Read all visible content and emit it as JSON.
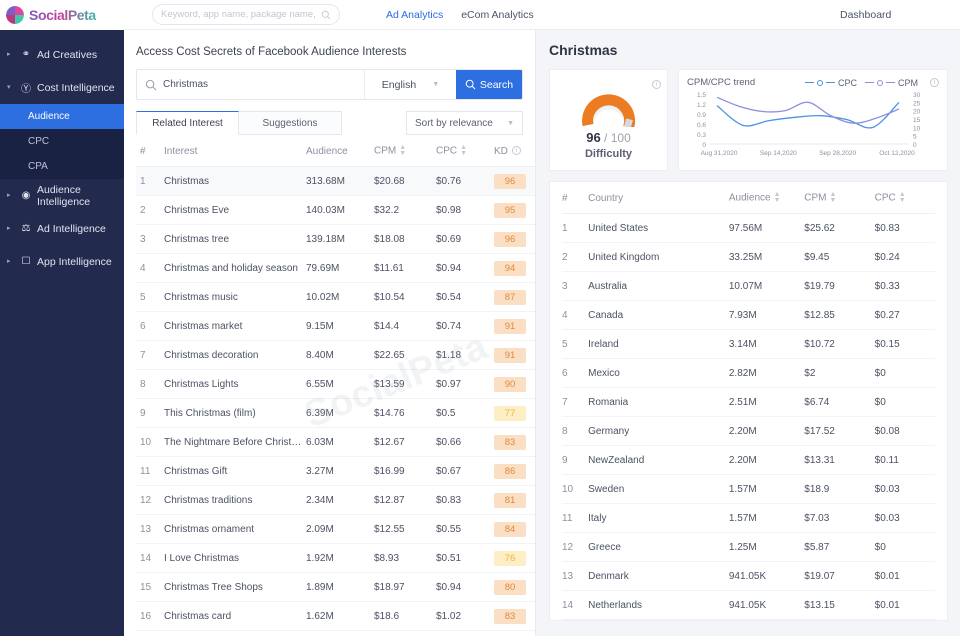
{
  "brand": {
    "name": "SocialPeta",
    "logo_icon": "socialpeta-logo-icon"
  },
  "topbar": {
    "search_placeholder": "Keyword, app name, package name, text ·",
    "search_value": "",
    "search_icon": "search-icon",
    "nav": [
      {
        "label": "Ad Analytics",
        "active": true
      },
      {
        "label": "eCom Analytics",
        "active": false
      }
    ],
    "dashboard_label": "Dashboard"
  },
  "sidebar": {
    "items": [
      {
        "label": "Ad Creatives",
        "icon": "lightbulb-icon",
        "caret": "▸",
        "expanded": false
      },
      {
        "label": "Cost Intelligence",
        "icon": "dollar-circle-icon",
        "caret": "▾",
        "expanded": true
      },
      {
        "label": "Audience Intelligence",
        "icon": "target-icon",
        "caret": "▸",
        "expanded": false
      },
      {
        "label": "Ad Intelligence",
        "icon": "trophy-icon",
        "caret": "▸",
        "expanded": false
      },
      {
        "label": "App Intelligence",
        "icon": "mobile-icon",
        "caret": "▸",
        "expanded": false
      }
    ],
    "cost_children": [
      {
        "label": "Audience",
        "active": true
      },
      {
        "label": "CPC",
        "active": false
      },
      {
        "label": "CPA",
        "active": false
      }
    ]
  },
  "main": {
    "title": "Access Cost Secrets of Facebook Audience Interests",
    "search": {
      "value": "Christmas",
      "placeholder": "Christmas",
      "search_icon": "search-icon",
      "language": "English",
      "language_chevron_icon": "chevron-down-icon",
      "button_label": "Search",
      "button_icon": "search-icon"
    },
    "tabs": [
      {
        "label": "Related Interest",
        "active": true
      },
      {
        "label": "Suggestions",
        "active": false
      }
    ],
    "sort": {
      "label": "Sort by relevance",
      "chevron_icon": "chevron-down-icon"
    },
    "table": {
      "headers": [
        "#",
        "Interest",
        "Audience",
        "CPM",
        "CPC",
        "KD"
      ],
      "kd_info_icon": "info-icon",
      "sortable": [
        "CPM",
        "CPC"
      ],
      "rows": [
        {
          "num": "1",
          "interest": "Christmas",
          "audience": "313.68M",
          "cpm": "$20.68",
          "cpc": "$0.76",
          "kd": "96"
        },
        {
          "num": "2",
          "interest": "Christmas Eve",
          "audience": "140.03M",
          "cpm": "$32.2",
          "cpc": "$0.98",
          "kd": "95"
        },
        {
          "num": "3",
          "interest": "Christmas tree",
          "audience": "139.18M",
          "cpm": "$18.08",
          "cpc": "$0.69",
          "kd": "96"
        },
        {
          "num": "4",
          "interest": "Christmas and holiday season",
          "audience": "79.69M",
          "cpm": "$11.61",
          "cpc": "$0.94",
          "kd": "94"
        },
        {
          "num": "5",
          "interest": "Christmas music",
          "audience": "10.02M",
          "cpm": "$10.54",
          "cpc": "$0.54",
          "kd": "87"
        },
        {
          "num": "6",
          "interest": "Christmas market",
          "audience": "9.15M",
          "cpm": "$14.4",
          "cpc": "$0.74",
          "kd": "91"
        },
        {
          "num": "7",
          "interest": "Christmas decoration",
          "audience": "8.40M",
          "cpm": "$22.65",
          "cpc": "$1.18",
          "kd": "91"
        },
        {
          "num": "8",
          "interest": "Christmas Lights",
          "audience": "6.55M",
          "cpm": "$13.59",
          "cpc": "$0.97",
          "kd": "90"
        },
        {
          "num": "9",
          "interest": "This Christmas (film)",
          "audience": "6.39M",
          "cpm": "$14.76",
          "cpc": "$0.5",
          "kd": "77"
        },
        {
          "num": "10",
          "interest": "The Nightmare Before Christ…",
          "audience": "6.03M",
          "cpm": "$12.67",
          "cpc": "$0.66",
          "kd": "83"
        },
        {
          "num": "11",
          "interest": "Christmas Gift",
          "audience": "3.27M",
          "cpm": "$16.99",
          "cpc": "$0.67",
          "kd": "86"
        },
        {
          "num": "12",
          "interest": "Christmas traditions",
          "audience": "2.34M",
          "cpm": "$12.87",
          "cpc": "$0.83",
          "kd": "81"
        },
        {
          "num": "13",
          "interest": "Christmas ornament",
          "audience": "2.09M",
          "cpm": "$12.55",
          "cpc": "$0.55",
          "kd": "84"
        },
        {
          "num": "14",
          "interest": "I Love Christmas",
          "audience": "1.92M",
          "cpm": "$8.93",
          "cpc": "$0.51",
          "kd": "76"
        },
        {
          "num": "15",
          "interest": "Christmas Tree Shops",
          "audience": "1.89M",
          "cpm": "$18.97",
          "cpc": "$0.94",
          "kd": "80"
        },
        {
          "num": "16",
          "interest": "Christmas card",
          "audience": "1.62M",
          "cpm": "$18.6",
          "cpc": "$1.02",
          "kd": "83"
        }
      ]
    }
  },
  "detail": {
    "title": "Christmas",
    "difficulty": {
      "value": "96",
      "out_of": "/ 100",
      "label": "Difficulty",
      "info_icon": "info-icon",
      "arc_color": "#ec7c22",
      "track_color": "#ffffff"
    },
    "trend": {
      "title": "CPM/CPC trend",
      "info_icon": "info-icon",
      "legend": [
        {
          "label": "CPC",
          "color": "#4a93e0"
        },
        {
          "label": "CPM",
          "color": "#8d8fe0"
        }
      ]
    },
    "country_table": {
      "headers": [
        "#",
        "Country",
        "Audience",
        "CPM",
        "CPC"
      ],
      "sortable": [
        "Audience",
        "CPM",
        "CPC"
      ],
      "rows": [
        {
          "num": "1",
          "country": "United States",
          "audience": "97.56M",
          "cpm": "$25.62",
          "cpc": "$0.83"
        },
        {
          "num": "2",
          "country": "United Kingdom",
          "audience": "33.25M",
          "cpm": "$9.45",
          "cpc": "$0.24"
        },
        {
          "num": "3",
          "country": "Australia",
          "audience": "10.07M",
          "cpm": "$19.79",
          "cpc": "$0.33"
        },
        {
          "num": "4",
          "country": "Canada",
          "audience": "7.93M",
          "cpm": "$12.85",
          "cpc": "$0.27"
        },
        {
          "num": "5",
          "country": "Ireland",
          "audience": "3.14M",
          "cpm": "$10.72",
          "cpc": "$0.15"
        },
        {
          "num": "6",
          "country": "Mexico",
          "audience": "2.82M",
          "cpm": "$2",
          "cpc": "$0"
        },
        {
          "num": "7",
          "country": "Romania",
          "audience": "2.51M",
          "cpm": "$6.74",
          "cpc": "$0"
        },
        {
          "num": "8",
          "country": "Germany",
          "audience": "2.20M",
          "cpm": "$17.52",
          "cpc": "$0.08"
        },
        {
          "num": "9",
          "country": "NewZealand",
          "audience": "2.20M",
          "cpm": "$13.31",
          "cpc": "$0.11"
        },
        {
          "num": "10",
          "country": "Sweden",
          "audience": "1.57M",
          "cpm": "$18.9",
          "cpc": "$0.03"
        },
        {
          "num": "11",
          "country": "Italy",
          "audience": "1.57M",
          "cpm": "$7.03",
          "cpc": "$0.03"
        },
        {
          "num": "12",
          "country": "Greece",
          "audience": "1.25M",
          "cpm": "$5.87",
          "cpc": "$0"
        },
        {
          "num": "13",
          "country": "Denmark",
          "audience": "941.05K",
          "cpm": "$19.07",
          "cpc": "$0.01"
        },
        {
          "num": "14",
          "country": "Netherlands",
          "audience": "941.05K",
          "cpm": "$13.15",
          "cpc": "$0.01"
        }
      ]
    }
  },
  "watermark": {
    "text": "SocialPeta"
  },
  "chart_data": {
    "type": "line",
    "title": "CPM/CPC trend",
    "x": [
      "Aug 31,2020",
      "Sep 14,2020",
      "Sep 28,2020",
      "Oct 12,2020"
    ],
    "xlabel": "",
    "left_axis": {
      "label": "CPC",
      "ticks": [
        "0",
        "0.3",
        "0.6",
        "0.9",
        "1.2",
        "1.5"
      ],
      "range": [
        0,
        1.5
      ]
    },
    "right_axis": {
      "label": "CPM",
      "ticks": [
        "0",
        "5",
        "10",
        "15",
        "20",
        "25",
        "30"
      ],
      "range": [
        0,
        30
      ]
    },
    "grid": false,
    "legend_position": "top-right",
    "series": [
      {
        "name": "CPC",
        "axis": "left",
        "color": "#4a93e0",
        "values": [
          1.15,
          0.56,
          0.7,
          0.8,
          0.85,
          0.73,
          0.5,
          1.25
        ]
      },
      {
        "name": "CPM",
        "axis": "right",
        "color": "#8d8fe0",
        "values": [
          28.0,
          22.5,
          19.5,
          20.0,
          25.0,
          17.0,
          12.5,
          15.5,
          21.0
        ]
      }
    ]
  }
}
